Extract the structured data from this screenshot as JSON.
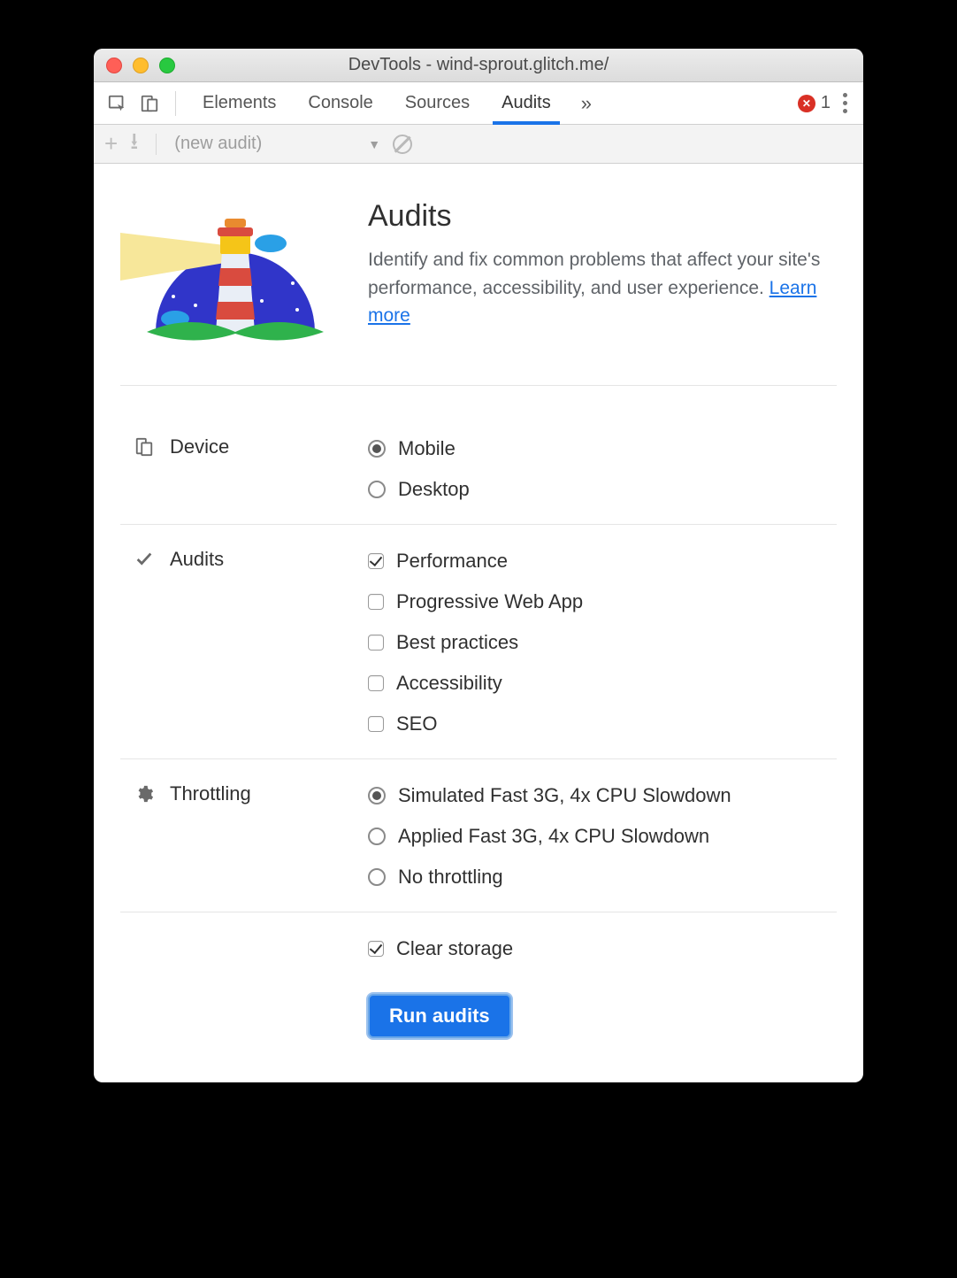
{
  "window": {
    "title": "DevTools - wind-sprout.glitch.me/"
  },
  "tabstrip": {
    "tabs": [
      "Elements",
      "Console",
      "Sources",
      "Audits"
    ],
    "active_index": 3,
    "overflow_glyph": "»",
    "error_count": "1"
  },
  "subbar": {
    "dropdown_label": "(new audit)"
  },
  "hero": {
    "heading": "Audits",
    "body": "Identify and fix common problems that affect your site's performance, accessibility, and user experience. ",
    "link": "Learn more"
  },
  "sections": {
    "device": {
      "label": "Device",
      "options": [
        {
          "label": "Mobile",
          "checked": true
        },
        {
          "label": "Desktop",
          "checked": false
        }
      ]
    },
    "audits": {
      "label": "Audits",
      "options": [
        {
          "label": "Performance",
          "checked": true
        },
        {
          "label": "Progressive Web App",
          "checked": false
        },
        {
          "label": "Best practices",
          "checked": false
        },
        {
          "label": "Accessibility",
          "checked": false
        },
        {
          "label": "SEO",
          "checked": false
        }
      ]
    },
    "throttling": {
      "label": "Throttling",
      "options": [
        {
          "label": "Simulated Fast 3G, 4x CPU Slowdown",
          "checked": true
        },
        {
          "label": "Applied Fast 3G, 4x CPU Slowdown",
          "checked": false
        },
        {
          "label": "No throttling",
          "checked": false
        }
      ]
    },
    "storage": {
      "label": "Clear storage",
      "checked": true
    }
  },
  "actions": {
    "run_label": "Run audits"
  }
}
